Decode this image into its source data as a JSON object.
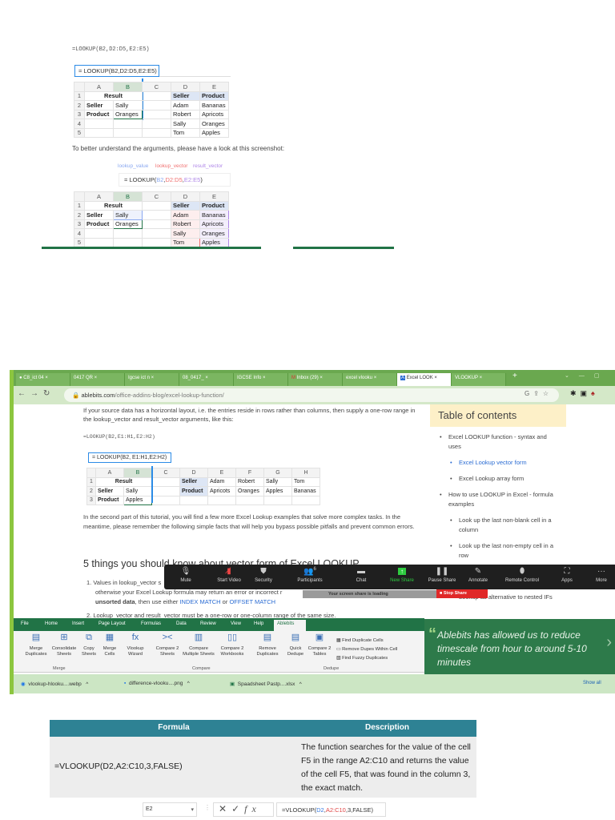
{
  "section1": {
    "formula_text": "=LOOKUP(B2,D2:D5,E2:E5)",
    "formula_box": "= LOOKUP(B2,D2:D5,E2:E5)",
    "columns": [
      "A",
      "B",
      "C",
      "D",
      "E"
    ],
    "rows": [
      {
        "n": "1",
        "a": "Result",
        "b": "",
        "c": "",
        "d": "Seller",
        "e": "Product"
      },
      {
        "n": "2",
        "a": "Seller",
        "b": "Sally",
        "c": "",
        "d": "Adam",
        "e": "Bananas"
      },
      {
        "n": "3",
        "a": "Product",
        "b": "Oranges",
        "c": "",
        "d": "Robert",
        "e": "Apricots"
      },
      {
        "n": "4",
        "a": "",
        "b": "",
        "c": "",
        "d": "Sally",
        "e": "Oranges"
      },
      {
        "n": "5",
        "a": "",
        "b": "",
        "c": "",
        "d": "Tom",
        "e": "Apples"
      }
    ],
    "paragraph": "To better understand the arguments, please have a look at this screenshot:",
    "labels": {
      "lookup_value": "lookup_value",
      "lookup_vector": "lookup_vector",
      "result_vector": "result_vector"
    },
    "formula2": {
      "prefix": "= LOOKUP(",
      "a1": "B2",
      ",": ",",
      "a2": "D2:D5",
      "a3": "E2:E5",
      "suffix": ")"
    }
  },
  "browser": {
    "tabs": [
      "C8_ict 04",
      "0417 QR",
      "Igcse ict n",
      "08_0417_",
      "IGCSE Info",
      "Inbox (29)",
      "excel vlooku",
      "Excel LOOK",
      "VLOOKUP"
    ],
    "new_tab": "+",
    "url_domain": "ablebits.com",
    "url_path": "/office-addins-blog/excel-lookup-function/",
    "article": {
      "p1": "If your source data has a horizontal layout, i.e. the entries reside in rows rather than columns, then supply a one-row range in the lookup_vector and result_vector arguments, like this:",
      "formula_text": "=LOOKUP(B2,E1:H1,E2:H2)",
      "formula_box": "= LOOKUP(B2, E1:H1,E2:H2)",
      "columns": [
        "A",
        "B",
        "C",
        "D",
        "E",
        "F",
        "G",
        "H"
      ],
      "rows": [
        {
          "n": "1",
          "cells": [
            "Result",
            "",
            "",
            "Seller",
            "Adam",
            "Robert",
            "Sally",
            "Tom"
          ]
        },
        {
          "n": "2",
          "cells": [
            "Seller",
            "Sally",
            "",
            "Product",
            "Apricots",
            "Oranges",
            "Apples",
            "Bananas"
          ]
        },
        {
          "n": "3",
          "cells": [
            "Product",
            "Apples",
            "",
            "",
            "",
            "",
            "",
            ""
          ]
        }
      ],
      "p2": "In the second part of this tutorial, you will find a few more Excel Lookup examples that solve more complex tasks. In the meantime, please remember the following simple facts that will help you bypass possible pitfalls and prevent common errors.",
      "heading": "5 things you should know about vector form of Excel LOOKUP",
      "li1a": "1.  Values in lookup_vector s",
      "li1b": "otherwise your Excel Lookup formula may return an error or incorrect r",
      "li1c_bold": "unsorted data",
      "li1c": ", then use either ",
      "link1": "INDEX MATCH",
      "or": " or ",
      "link2": "OFFSET MATCH",
      "li2": "2.  Lookup_vector and result_vector must be a one-row or one-column range of the same size."
    },
    "toc": {
      "title": "Table of contents",
      "items": [
        "Excel LOOKUP function - syntax and uses",
        "Excel Lookup vector form",
        "Excel Lookup array form",
        "How to use LOOKUP in Excel - formula examples",
        "Look up the last non-blank cell in a column",
        "Look up the last non-empty cell in a row"
      ],
      "partial": "Lookup as alternative to nested IFs"
    },
    "zoom": {
      "buttons": [
        "Mute",
        "Start Video",
        "Security",
        "Participants",
        "Chat",
        "New Share",
        "Pause Share",
        "Annotate",
        "Remote Control",
        "Apps",
        "More"
      ],
      "participants_count": "6",
      "loading": "Your screen share is loading",
      "stop_share": "Stop Share"
    },
    "ribbon": {
      "tabs": [
        "File",
        "Home",
        "Insert",
        "Page Layout",
        "Formulas",
        "Data",
        "Review",
        "View",
        "Help",
        "Ablebits"
      ],
      "buttons": [
        "Merge Duplicates",
        "Consolidate Sheets",
        "Copy Sheets",
        "Merge Cells",
        "Vlookup Wizard",
        "Compare 2 Sheets",
        "Compare Multiple Sheets",
        "Compare 2 Workbooks",
        "Remove Duplicates",
        "Quick Dedupe",
        "Compare 2 Tables"
      ],
      "small": [
        "Find Duplicate Cells",
        "Remove Dupes Within Cell",
        "Find Fuzzy Duplicates"
      ],
      "groups": [
        "Merge",
        "Compare",
        "Dedupe"
      ]
    },
    "testimonial": "Ablebits has allowed us to reduce timescale from hour to around 5-10 minutes",
    "downloads": [
      "vlookup-hlooku....webp",
      "difference-vlooku....png",
      "Spaadsheet Pastp....xlsx"
    ],
    "show_all": "Show all"
  },
  "section3": {
    "headers": [
      "Formula",
      "Description"
    ],
    "formula": "=VLOOKUP(D2,A2:C10,3,FALSE)",
    "description": "The function searches for the value of the cell F5 in the range A2:C10 and returns the value of the cell F5, that was found in the column 3, the exact match.",
    "name_box": "E2",
    "bar": {
      "p": "=VLOOKUP(",
      "a": "D2",
      "c": ",",
      "b": "A2:C10",
      "s": ",3,FALSE)"
    }
  },
  "colors": {
    "excel_green": "#217346",
    "browser_green": "#7bb661",
    "teal": "#2e8294",
    "zoom_bar": "#1f1f1f",
    "stop_red": "#e02828"
  }
}
